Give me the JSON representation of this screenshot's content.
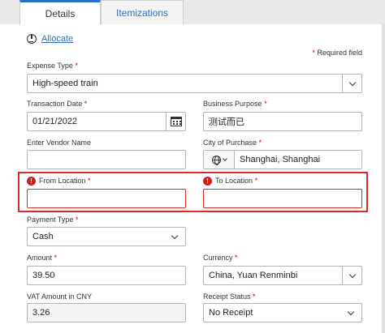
{
  "tabs": {
    "details": "Details",
    "itemizations": "Itemizations"
  },
  "allocate": {
    "label": "Allocate"
  },
  "required_note": {
    "star": "*",
    "text": "Required field"
  },
  "fields": {
    "expense_type": {
      "label": "Expense Type",
      "value": "High-speed train",
      "required": "*"
    },
    "transaction_date": {
      "label": "Transaction Date",
      "value": "01/21/2022",
      "required": "*"
    },
    "business_purpose": {
      "label": "Business Purpose",
      "value": "测试而已",
      "required": "*"
    },
    "vendor_name": {
      "label": "Enter Vendor Name",
      "value": ""
    },
    "city_of_purchase": {
      "label": "City of Purchase",
      "value": "Shanghai, Shanghai",
      "required": "*"
    },
    "from_location": {
      "label": "From Location",
      "value": "",
      "required": "*"
    },
    "to_location": {
      "label": "To Location",
      "value": "",
      "required": "*"
    },
    "payment_type": {
      "label": "Payment Type",
      "value": "Cash",
      "required": "*"
    },
    "amount": {
      "label": "Amount",
      "value": "39.50",
      "required": "*"
    },
    "currency": {
      "label": "Currency",
      "value": "China, Yuan Renminbi",
      "required": "*"
    },
    "vat_amount": {
      "label": "VAT Amount in CNY",
      "value": "3.26"
    },
    "receipt_status": {
      "label": "Receipt Status",
      "value": "No Receipt",
      "required": "*"
    }
  },
  "icons": {
    "error": "!",
    "calendar": "calendar-icon",
    "globe": "globe-icon"
  },
  "colors": {
    "accent": "#2d6fc2",
    "error": "#d92b2b",
    "required": "#cc0000"
  }
}
